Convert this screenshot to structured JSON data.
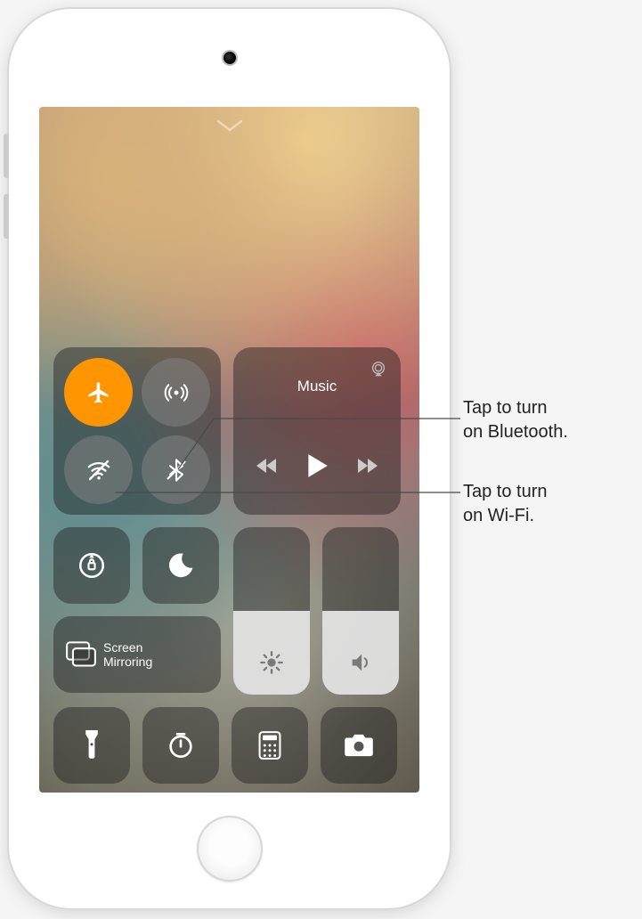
{
  "callouts": {
    "bluetooth": "Tap to turn\non Bluetooth.",
    "wifi": "Tap to turn\non Wi-Fi."
  },
  "connectivity": {
    "airplane": {
      "name": "airplane-mode-icon",
      "state": "on"
    },
    "airdrop": {
      "name": "airdrop-icon",
      "state": "off"
    },
    "wifi": {
      "name": "wifi-off-icon",
      "state": "off"
    },
    "bluetooth": {
      "name": "bluetooth-off-icon",
      "state": "off"
    }
  },
  "media": {
    "title": "Music",
    "airplay_icon": "airplay-icon",
    "prev_icon": "previous-track-icon",
    "play_icon": "play-icon",
    "next_icon": "next-track-icon"
  },
  "toggles": {
    "orientation_lock": "orientation-lock-icon",
    "dnd": "do-not-disturb-icon"
  },
  "mirroring": {
    "icon": "screen-mirroring-icon",
    "label": "Screen\nMirroring"
  },
  "sliders": {
    "brightness": {
      "icon": "brightness-icon",
      "fill_percent": 50
    },
    "volume": {
      "icon": "volume-icon",
      "fill_percent": 50
    }
  },
  "shortcuts": {
    "flashlight": "flashlight-icon",
    "timer": "timer-icon",
    "calculator": "calculator-icon",
    "camera": "camera-icon"
  },
  "colors": {
    "active_orange": "#ff9500",
    "module_bg": "rgba(30,30,30,0.45)"
  }
}
